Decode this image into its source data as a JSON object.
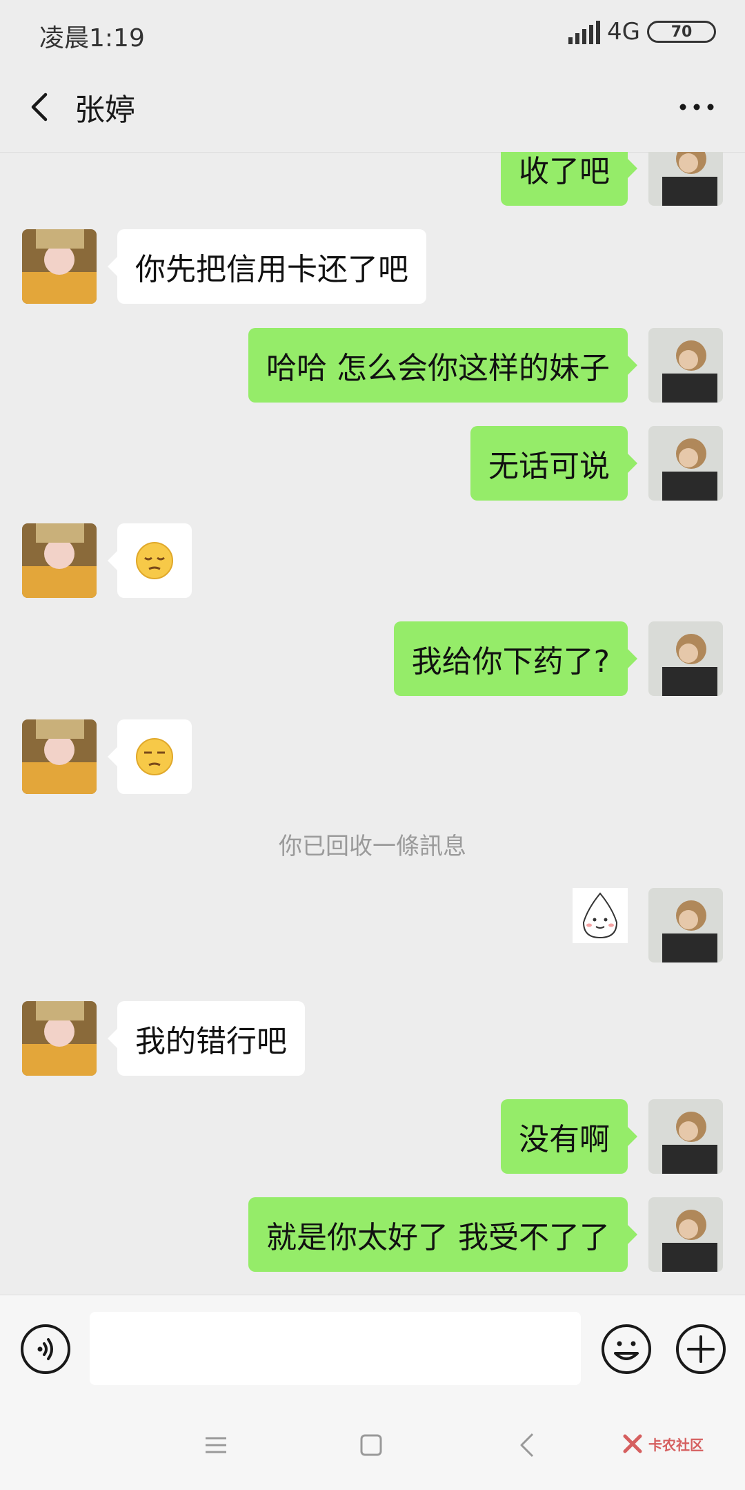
{
  "status_bar": {
    "time": "凌晨1:19",
    "network": "4G",
    "battery": "70"
  },
  "header": {
    "title": "张婷"
  },
  "messages": [
    {
      "side": "right",
      "text": "收了吧"
    },
    {
      "side": "left",
      "text": "你先把信用卡还了吧"
    },
    {
      "side": "right",
      "text": "哈哈 怎么会你这样的妹子"
    },
    {
      "side": "right",
      "text": "无话可说"
    },
    {
      "side": "left",
      "type": "emoji",
      "emoji": "pensive-face-icon"
    },
    {
      "side": "right",
      "text": "我给你下药了?"
    },
    {
      "side": "left",
      "type": "emoji",
      "emoji": "unamused-face-icon"
    },
    {
      "type": "system",
      "text": "你已回收一條訊息"
    },
    {
      "side": "right",
      "type": "sticker",
      "sticker": "meme-sticker"
    },
    {
      "side": "left",
      "text": "我的错行吧"
    },
    {
      "side": "right",
      "text": "没有啊"
    },
    {
      "side": "right",
      "text": "就是你太好了 我受不了了"
    }
  ],
  "input_bar": {
    "placeholder": ""
  },
  "watermark": {
    "text": "卡农社区"
  },
  "colors": {
    "bubble_sent": "#95ec69",
    "bubble_received": "#ffffff",
    "background": "#ededed"
  }
}
